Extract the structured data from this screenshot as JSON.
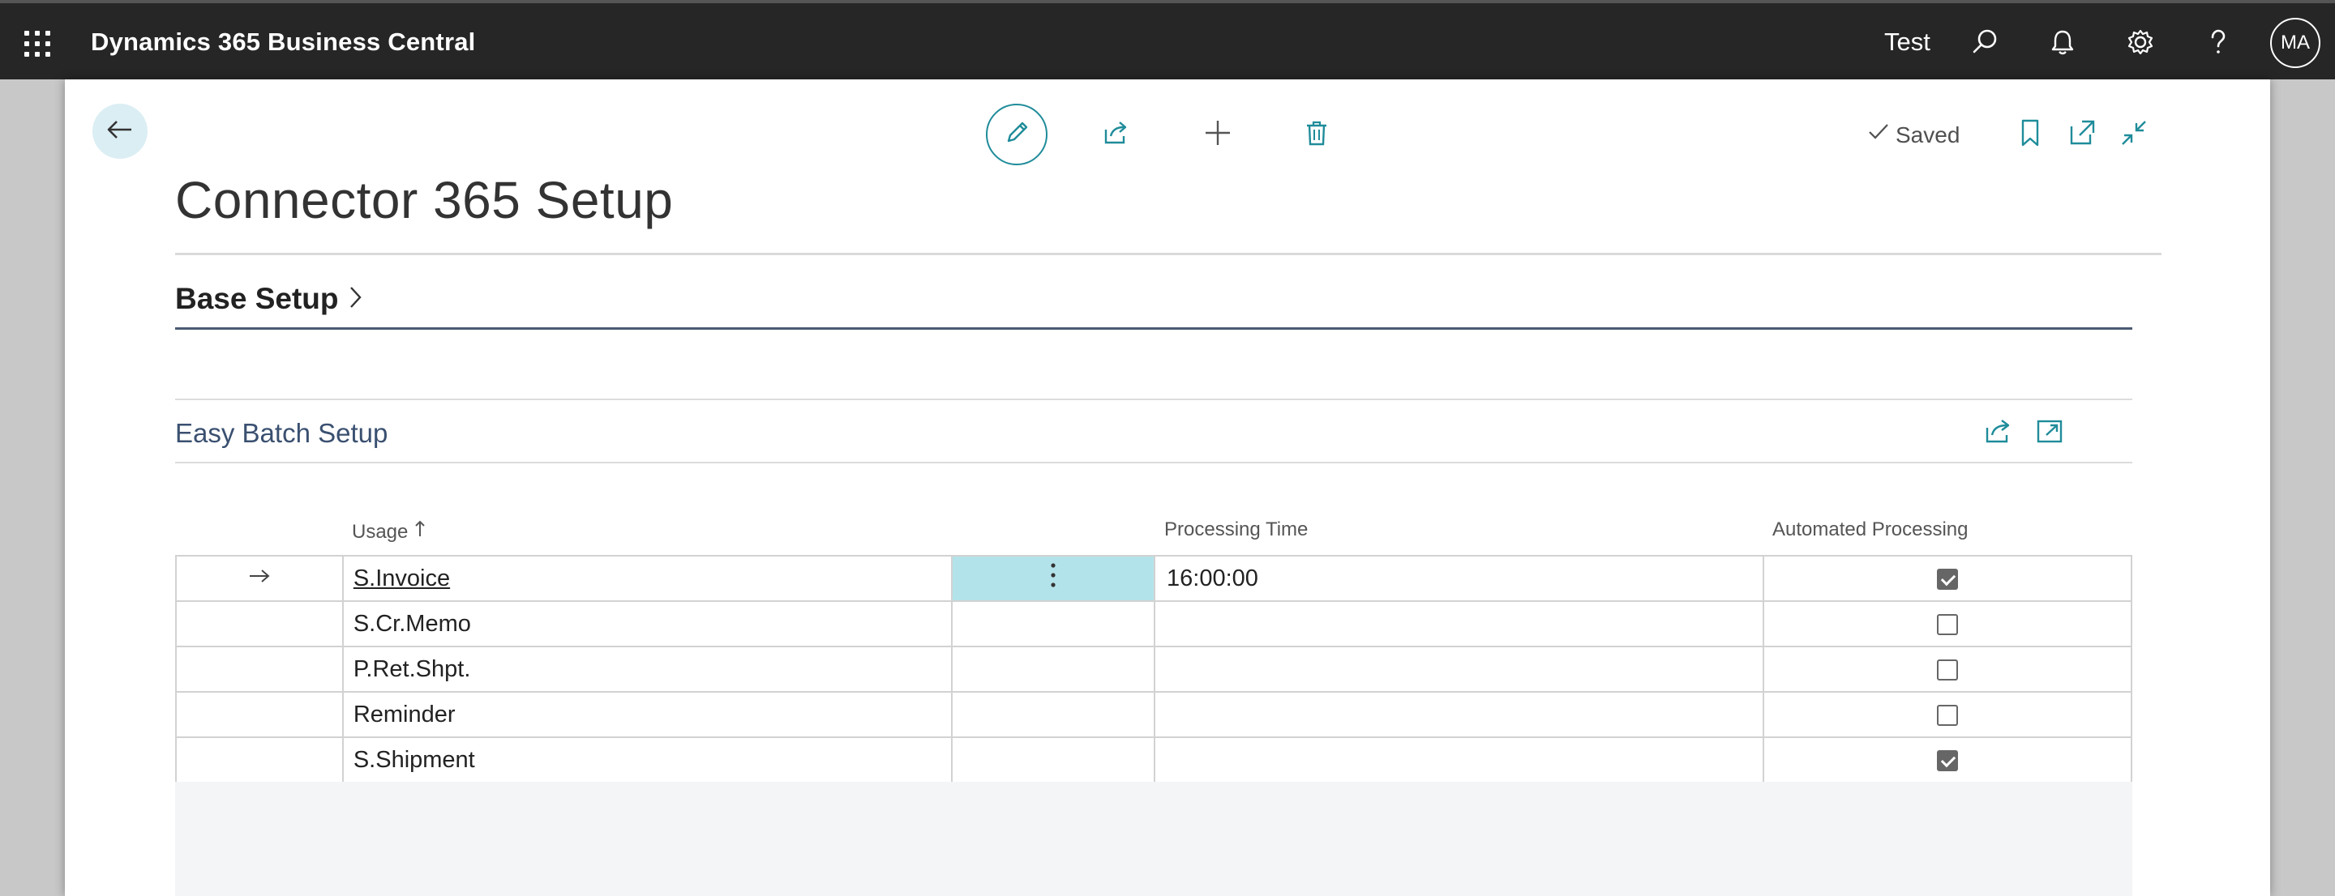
{
  "navbar": {
    "app_title": "Dynamics 365 Business Central",
    "company": "Test",
    "icons": [
      "app-launcher-icon",
      "search-icon",
      "bell-icon",
      "gear-icon",
      "help-icon"
    ],
    "avatar_initials": "MA",
    "background": "#262626"
  },
  "toolbar": {
    "icons": [
      "back-arrow-icon",
      "pencil-icon",
      "share-icon",
      "plus-icon",
      "trash-icon",
      "bookmark-icon",
      "open-new-window-icon",
      "collapse-icon"
    ],
    "saved_label": "Saved"
  },
  "page": {
    "title": "Connector 365 Setup"
  },
  "base_setup": {
    "label": "Base Setup"
  },
  "easy_batch": {
    "title": "Easy Batch Setup",
    "columns": {
      "usage": "Usage",
      "processing_time": "Processing Time",
      "automated_processing": "Automated Processing"
    },
    "rows": [
      {
        "usage": "S.Invoice",
        "processing_time": "16:00:00",
        "automated": true
      },
      {
        "usage": "S.Cr.Memo",
        "processing_time": "",
        "automated": false
      },
      {
        "usage": "P.Ret.Shpt.",
        "processing_time": "",
        "automated": false
      },
      {
        "usage": "Reminder",
        "processing_time": "",
        "automated": false
      },
      {
        "usage": "S.Shipment",
        "processing_time": "",
        "automated": true
      }
    ]
  },
  "colors": {
    "accent": "#1f8c9a",
    "selected_cell": "#b3e3ea",
    "fasttab_rule": "#4a5a72"
  }
}
